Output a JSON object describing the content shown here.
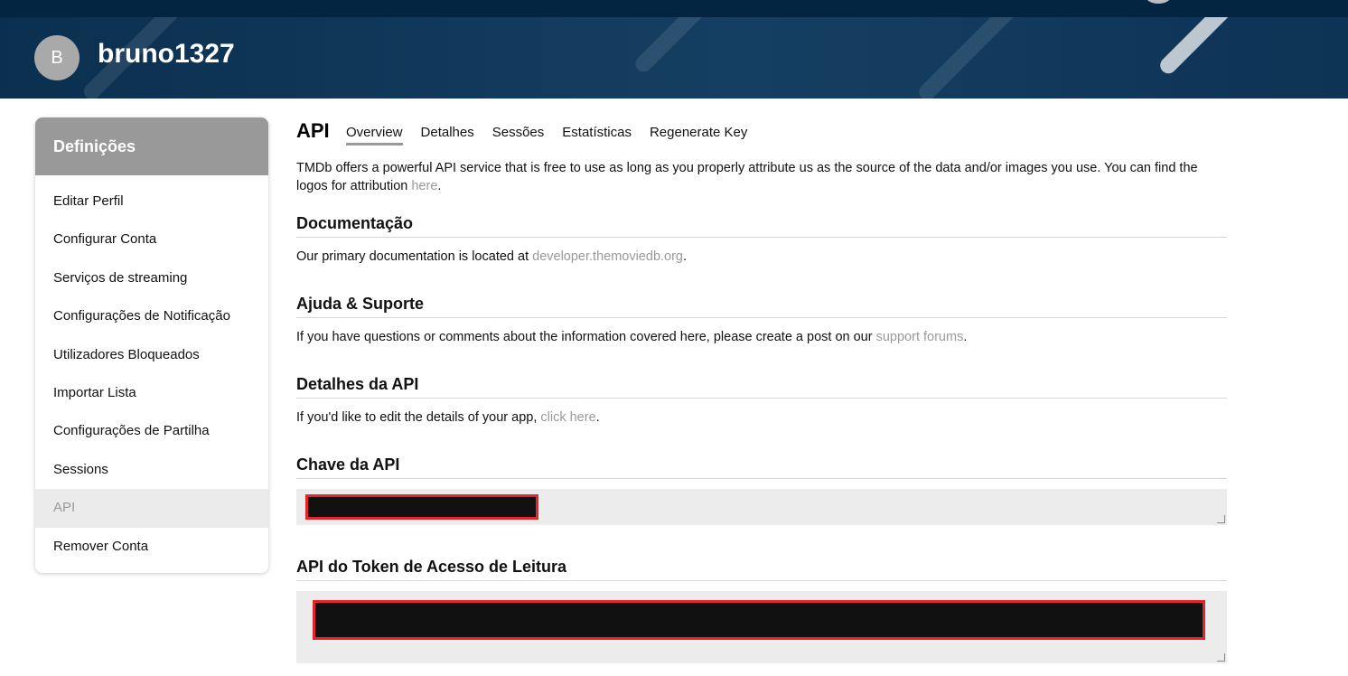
{
  "header": {
    "avatar_letter": "B",
    "username": "bruno1327"
  },
  "sidebar": {
    "title": "Definições",
    "items": [
      {
        "label": "Editar Perfil"
      },
      {
        "label": "Configurar Conta"
      },
      {
        "label": "Serviços de streaming"
      },
      {
        "label": "Configurações de Notificação"
      },
      {
        "label": "Utilizadores Bloqueados"
      },
      {
        "label": "Importar Lista"
      },
      {
        "label": "Configurações de Partilha"
      },
      {
        "label": "Sessions"
      },
      {
        "label": "API",
        "active": true
      },
      {
        "label": "Remover Conta"
      }
    ]
  },
  "main": {
    "title": "API",
    "tabs": [
      "Overview",
      "Detalhes",
      "Sessões",
      "Estatísticas",
      "Regenerate Key"
    ],
    "intro_text": "TMDb offers a powerful API service that is free to use as long as you properly attribute us as the source of the data and/or images you use. You can find the logos for attribution",
    "intro_link": "here",
    "documentation": {
      "title": "Documentação",
      "text": "Our primary documentation is located at",
      "link": "developer.themoviedb.org"
    },
    "support": {
      "title": "Ajuda & Suporte",
      "text": "If you have questions or comments about the information covered here, please create a post on our",
      "link": "support forums"
    },
    "api_details": {
      "title": "Detalhes da API",
      "text": "If you'd like to edit the details of your app,",
      "link": "click here"
    },
    "api_key": {
      "title": "Chave da API"
    },
    "read_token": {
      "title": "API do Token de Acesso de Leitura"
    }
  },
  "colors": {
    "header_bg": "#032541",
    "sidebar_header_bg": "#999999",
    "active_item_bg": "#ebebeb",
    "link": "#9a9a9a",
    "redaction_border": "#e3262c"
  }
}
